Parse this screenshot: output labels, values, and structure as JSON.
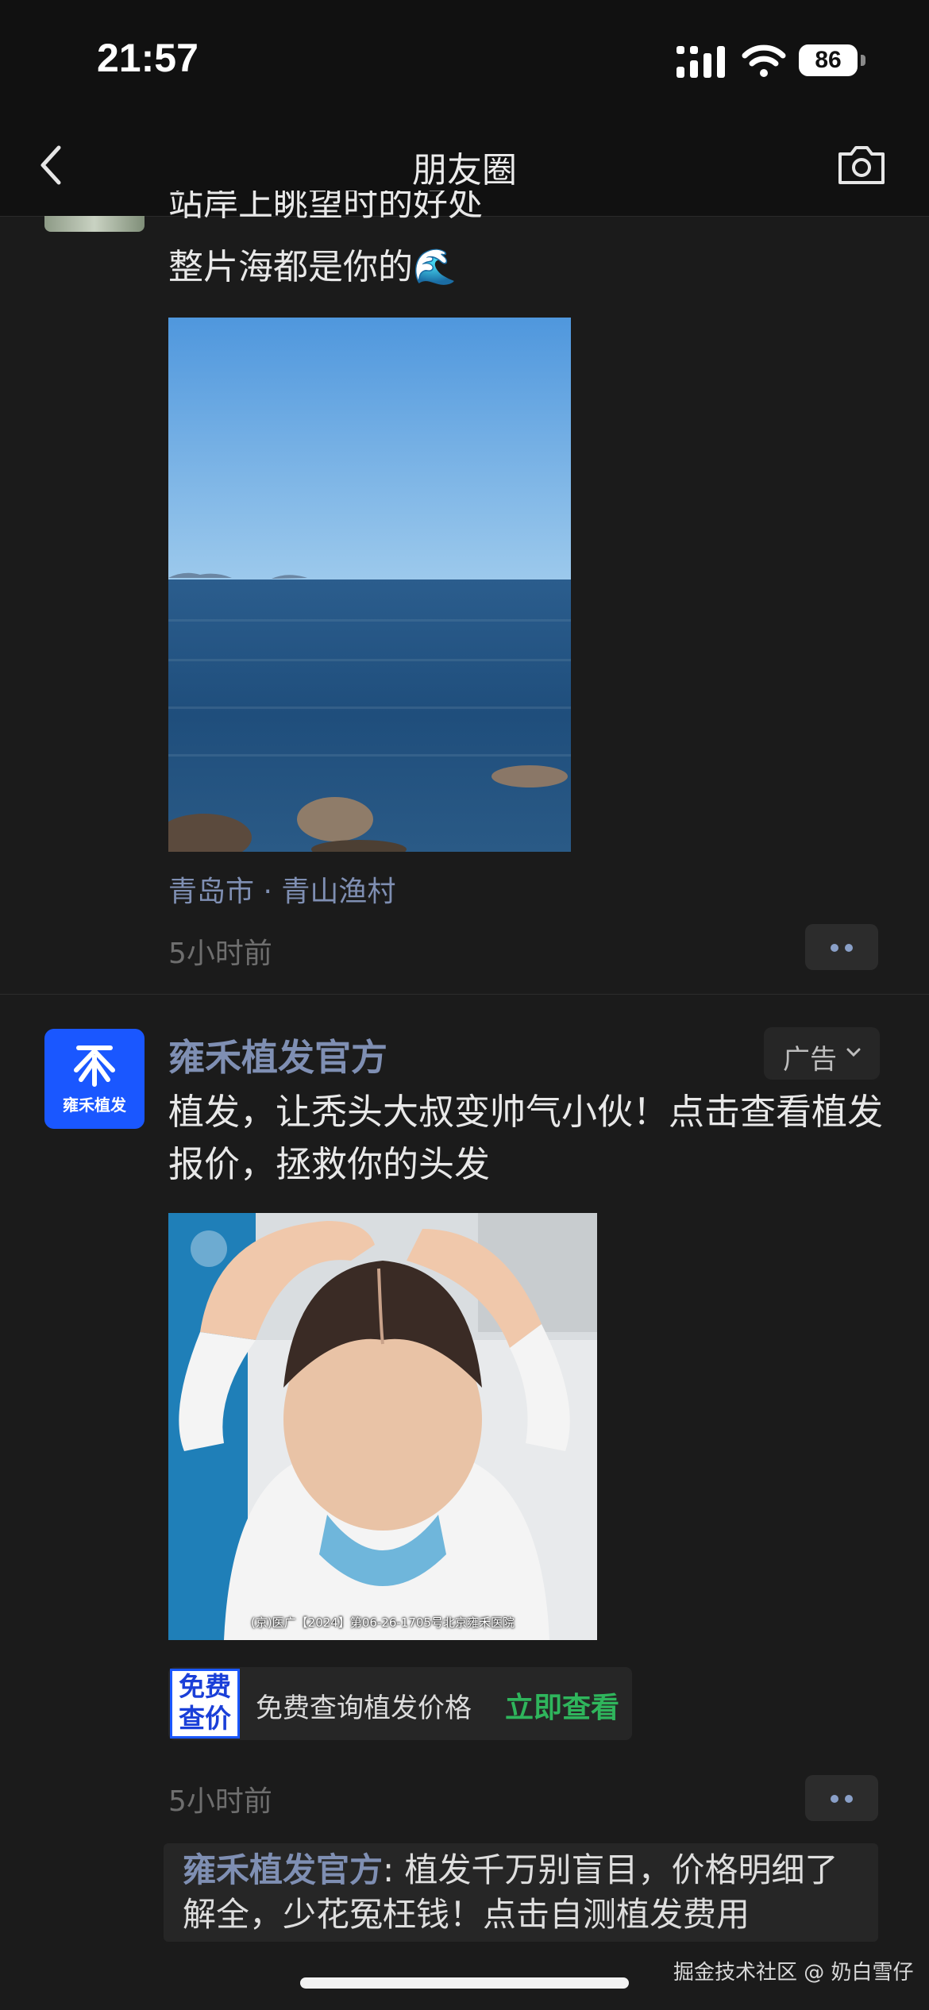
{
  "status_bar": {
    "time": "21:57",
    "battery": "86",
    "icons": [
      "signal-bars-icon",
      "wifi-icon",
      "battery-icon"
    ]
  },
  "nav": {
    "title": "朋友圈",
    "back_icon": "chevron-left-icon",
    "camera_icon": "camera-icon"
  },
  "post1": {
    "text_partial": "站岸上眺望时的好处",
    "text": "整片海都是你的🌊",
    "location": "青岛市 · 青山渔村",
    "time": "5小时前"
  },
  "ad_post": {
    "name": "雍禾植发官方",
    "avatar_text": "雍禾植发",
    "ad_label": "广告",
    "text": "植发，让秃头大叔变帅气小伙！点击查看植发报价，拯救你的头发",
    "image_caption": "(京)医广【2024】第06-26-1705号北京雍禾医院",
    "promo": {
      "icon_line1": "免费",
      "icon_line2": "查价",
      "text": "免费查询植发价格",
      "cta": "立即查看"
    },
    "time": "5小时前",
    "comment": {
      "author": "雍禾植发官方",
      "text": ": 植发千万别盲目，价格明细了解全，少花冤枉钱！点击自测植发费用"
    }
  },
  "watermark": "掘金技术社区 @ 奶白雪仔",
  "colors": {
    "background": "#1b1b1b",
    "link_blue": "#7f8fb3",
    "brand_blue": "#1a57ff",
    "cta_green": "#2fb55c"
  }
}
